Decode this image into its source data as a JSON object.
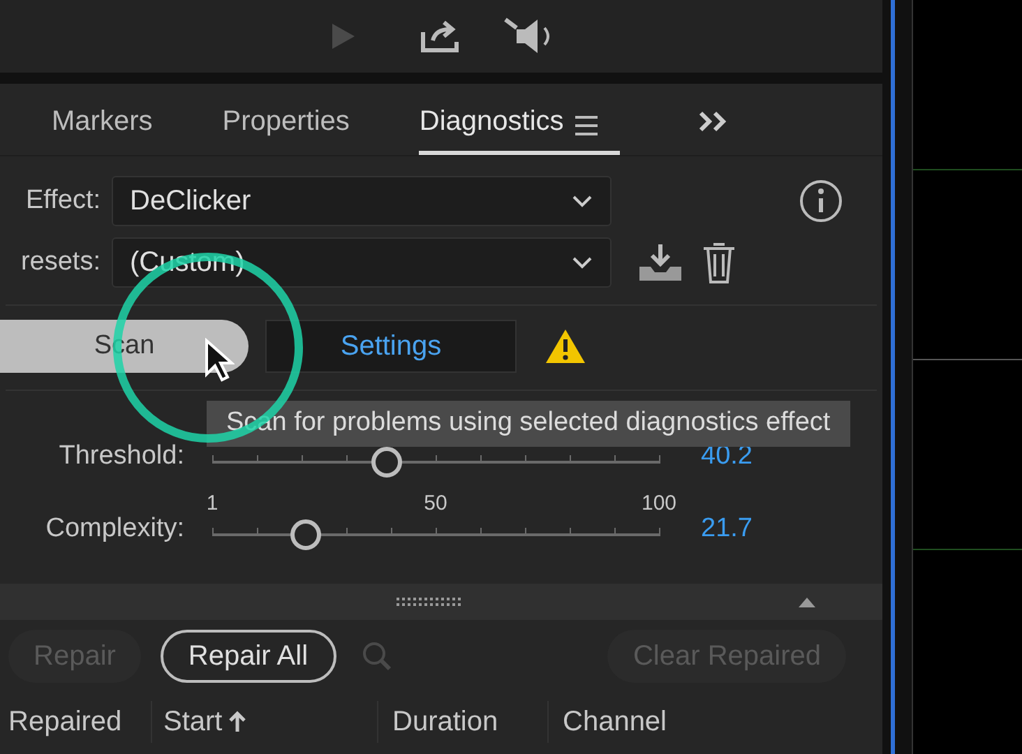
{
  "tabs": [
    {
      "label": "Markers",
      "selected": false
    },
    {
      "label": "Properties",
      "selected": false
    },
    {
      "label": "Diagnostics",
      "selected": true
    }
  ],
  "effect": {
    "label": "Effect:",
    "value": "DeClicker"
  },
  "presets": {
    "label": "resets:",
    "value": "(Custom)"
  },
  "scan_button": "Scan",
  "settings_button": "Settings",
  "tooltip": "Scan for problems using selected diagnostics effect",
  "sliders": [
    {
      "label": "Threshold:",
      "level": 0.39,
      "reading": "40.2"
    },
    {
      "label": "Complexity:",
      "level": 0.21,
      "reading": "21.7",
      "scale": [
        "1",
        "50",
        "100"
      ]
    }
  ],
  "actions": [
    {
      "label": "Repair",
      "disabled": true
    },
    {
      "label": "Repair All",
      "disabled": false
    }
  ],
  "clear_button": {
    "label": "Clear Repaired",
    "disabled": true
  },
  "columns": [
    "Repaired",
    "Start",
    "Duration",
    "Channel"
  ]
}
